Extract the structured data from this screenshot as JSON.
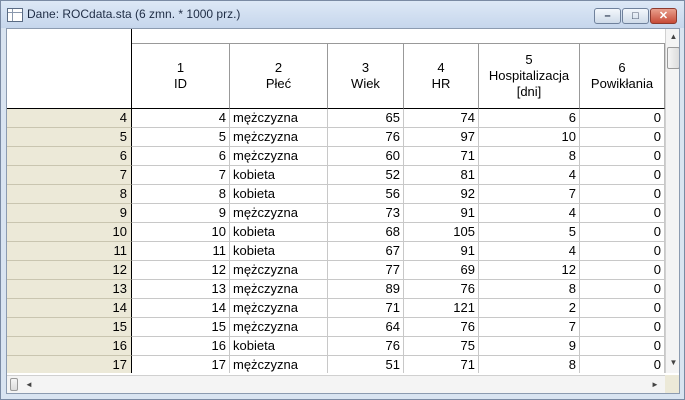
{
  "window": {
    "title": "Dane: ROCdata.sta (6 zmn. * 1000 prz.)",
    "controls": {
      "minimize": "–",
      "maximize": "□",
      "close": "✕"
    }
  },
  "icons": {
    "app": "spreadsheet-icon",
    "scroll_up": "▲",
    "scroll_down": "▼",
    "scroll_left": "◄",
    "scroll_right": "►"
  },
  "colors": {
    "rowhead_bg": "#ece9d8",
    "titlebar": "#c6d6ec",
    "close": "#c74b37"
  },
  "columns": [
    {
      "num": "1",
      "name": "ID",
      "name2": ""
    },
    {
      "num": "2",
      "name": "Płeć",
      "name2": ""
    },
    {
      "num": "3",
      "name": "Wiek",
      "name2": ""
    },
    {
      "num": "4",
      "name": "HR",
      "name2": ""
    },
    {
      "num": "5",
      "name": "Hospitalizacja",
      "name2": "[dni]"
    },
    {
      "num": "6",
      "name": "Powikłania",
      "name2": ""
    }
  ],
  "rows": [
    {
      "case": "4",
      "id": "4",
      "plec": "mężczyzna",
      "wiek": "65",
      "hr": "74",
      "hosp": "6",
      "pow": "0"
    },
    {
      "case": "5",
      "id": "5",
      "plec": "mężczyzna",
      "wiek": "76",
      "hr": "97",
      "hosp": "10",
      "pow": "0"
    },
    {
      "case": "6",
      "id": "6",
      "plec": "mężczyzna",
      "wiek": "60",
      "hr": "71",
      "hosp": "8",
      "pow": "0"
    },
    {
      "case": "7",
      "id": "7",
      "plec": "kobieta",
      "wiek": "52",
      "hr": "81",
      "hosp": "4",
      "pow": "0"
    },
    {
      "case": "8",
      "id": "8",
      "plec": "kobieta",
      "wiek": "56",
      "hr": "92",
      "hosp": "7",
      "pow": "0"
    },
    {
      "case": "9",
      "id": "9",
      "plec": "mężczyzna",
      "wiek": "73",
      "hr": "91",
      "hosp": "4",
      "pow": "0"
    },
    {
      "case": "10",
      "id": "10",
      "plec": "kobieta",
      "wiek": "68",
      "hr": "105",
      "hosp": "5",
      "pow": "0"
    },
    {
      "case": "11",
      "id": "11",
      "plec": "kobieta",
      "wiek": "67",
      "hr": "91",
      "hosp": "4",
      "pow": "0"
    },
    {
      "case": "12",
      "id": "12",
      "plec": "mężczyzna",
      "wiek": "77",
      "hr": "69",
      "hosp": "12",
      "pow": "0"
    },
    {
      "case": "13",
      "id": "13",
      "plec": "mężczyzna",
      "wiek": "89",
      "hr": "76",
      "hosp": "8",
      "pow": "0"
    },
    {
      "case": "14",
      "id": "14",
      "plec": "mężczyzna",
      "wiek": "71",
      "hr": "121",
      "hosp": "2",
      "pow": "0"
    },
    {
      "case": "15",
      "id": "15",
      "plec": "mężczyzna",
      "wiek": "64",
      "hr": "76",
      "hosp": "7",
      "pow": "0"
    },
    {
      "case": "16",
      "id": "16",
      "plec": "kobieta",
      "wiek": "76",
      "hr": "75",
      "hosp": "9",
      "pow": "0"
    },
    {
      "case": "17",
      "id": "17",
      "plec": "mężczyzna",
      "wiek": "51",
      "hr": "71",
      "hosp": "8",
      "pow": "0"
    }
  ]
}
